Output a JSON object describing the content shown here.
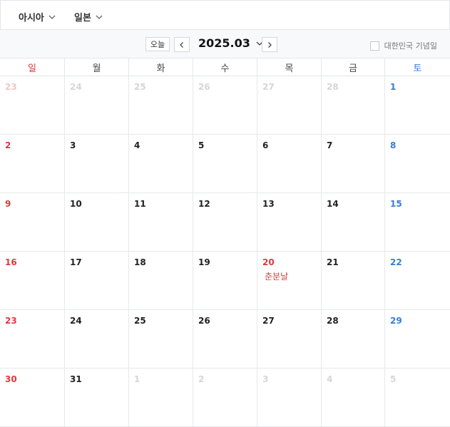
{
  "region_selector": {
    "label": "아시아"
  },
  "country_selector": {
    "label": "일본"
  },
  "toolbar": {
    "today_label": "오늘",
    "current_month": "2025.03",
    "holiday_toggle_label": "대한민국 기념일",
    "holiday_toggle_checked": false
  },
  "weekdays": [
    "일",
    "월",
    "화",
    "수",
    "목",
    "금",
    "토"
  ],
  "weeks": [
    [
      {
        "d": "23",
        "other": true
      },
      {
        "d": "24",
        "other": true
      },
      {
        "d": "25",
        "other": true
      },
      {
        "d": "26",
        "other": true
      },
      {
        "d": "27",
        "other": true
      },
      {
        "d": "28",
        "other": true
      },
      {
        "d": "1"
      }
    ],
    [
      {
        "d": "2"
      },
      {
        "d": "3"
      },
      {
        "d": "4"
      },
      {
        "d": "5"
      },
      {
        "d": "6"
      },
      {
        "d": "7"
      },
      {
        "d": "8"
      }
    ],
    [
      {
        "d": "9"
      },
      {
        "d": "10"
      },
      {
        "d": "11"
      },
      {
        "d": "12"
      },
      {
        "d": "13"
      },
      {
        "d": "14"
      },
      {
        "d": "15"
      }
    ],
    [
      {
        "d": "16"
      },
      {
        "d": "17"
      },
      {
        "d": "18"
      },
      {
        "d": "19"
      },
      {
        "d": "20",
        "holiday": "춘분날"
      },
      {
        "d": "21"
      },
      {
        "d": "22"
      }
    ],
    [
      {
        "d": "23"
      },
      {
        "d": "24"
      },
      {
        "d": "25"
      },
      {
        "d": "26"
      },
      {
        "d": "27"
      },
      {
        "d": "28"
      },
      {
        "d": "29"
      }
    ],
    [
      {
        "d": "30"
      },
      {
        "d": "31"
      },
      {
        "d": "1",
        "other": true
      },
      {
        "d": "2",
        "other": true
      },
      {
        "d": "3",
        "other": true
      },
      {
        "d": "4",
        "other": true
      },
      {
        "d": "5",
        "other": true
      }
    ]
  ],
  "colors": {
    "sunday": "#e0383e",
    "saturday": "#3a7bd5",
    "holiday": "#e0383e"
  }
}
